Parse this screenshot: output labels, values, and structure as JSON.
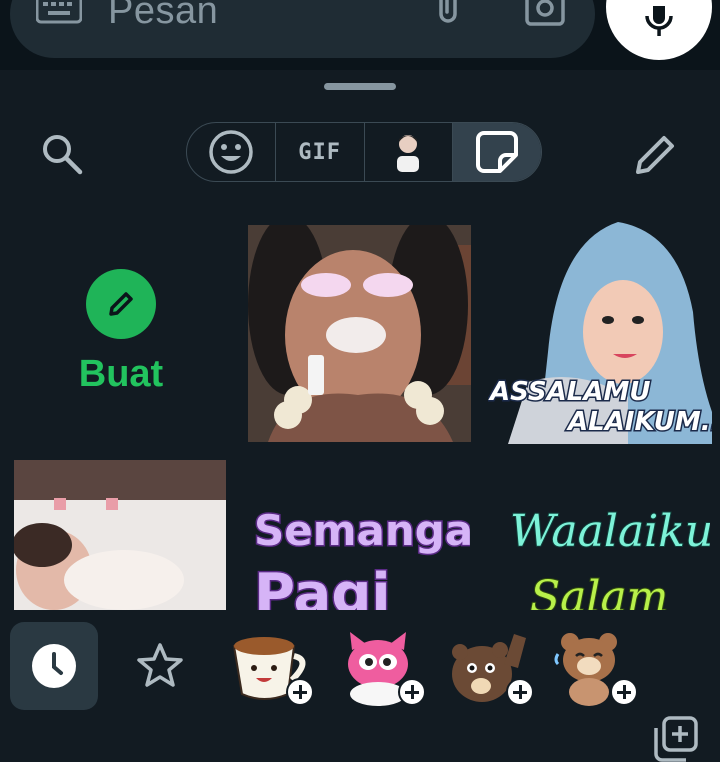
{
  "input_bar": {
    "placeholder": "Pesan",
    "keyboard_icon": "keyboard-icon",
    "attach_icon": "paperclip-icon",
    "camera_icon": "camera-icon",
    "mic_icon": "microphone-icon"
  },
  "panel": {
    "tabs": [
      {
        "name": "emoji",
        "icon": "emoji-icon",
        "active": false
      },
      {
        "name": "gif",
        "label": "GIF",
        "active": false
      },
      {
        "name": "avatar",
        "icon": "avatar-icon",
        "active": false
      },
      {
        "name": "sticker",
        "icon": "sticker-icon",
        "active": true
      }
    ],
    "create_label": "Buat",
    "stickers": [
      {
        "name": "sticker-girl-face"
      },
      {
        "name": "sticker-assalamu",
        "text_line1": "ASSALAMU",
        "text_line2": "ALAIKUM.."
      },
      {
        "name": "sticker-baby"
      },
      {
        "name": "sticker-semangat",
        "text_line1": "Semangat",
        "text_line2": "Pagi"
      },
      {
        "name": "sticker-waalaikum",
        "text_line1": "Waalaikum",
        "text_line2": "Salam"
      }
    ]
  },
  "colors": {
    "background": "#121b22",
    "accent_green": "#1fb458",
    "icon_gray": "#aebac1"
  }
}
